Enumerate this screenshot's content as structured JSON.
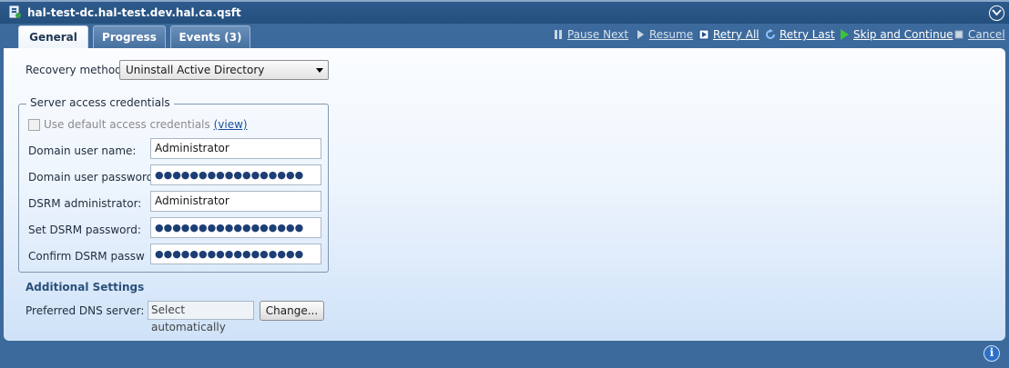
{
  "window": {
    "title": "hal-test-dc.hal-test.dev.hal.ca.qsft"
  },
  "tabs": [
    {
      "label": "General",
      "active": true
    },
    {
      "label": "Progress",
      "active": false
    },
    {
      "label": "Events (3)",
      "active": false
    }
  ],
  "toolbar": {
    "pause_next": "Pause Next",
    "resume": "Resume",
    "retry_all": "Retry All",
    "retry_last": "Retry Last",
    "skip_continue": "Skip and Continue",
    "cancel": "Cancel"
  },
  "general": {
    "recovery_method_label": "Recovery method:",
    "recovery_method_value": "Uninstall Active Directory",
    "credentials_legend": "Server access credentials",
    "use_default_label": "Use default access credentials",
    "use_default_link": "(view)",
    "use_default_checked": false,
    "domain_user_label": "Domain user name:",
    "domain_user_value": "Administrator",
    "domain_password_label": "Domain user password:",
    "domain_password_value": "●●●●●●●●●●●●●●●●●",
    "dsrm_admin_label": "DSRM administrator:",
    "dsrm_admin_value": "Administrator",
    "set_dsrm_password_label": "Set DSRM password:",
    "set_dsrm_password_value": "●●●●●●●●●●●●●●●●●",
    "confirm_dsrm_password_label": "Confirm DSRM passwor",
    "confirm_dsrm_password_value": "●●●●●●●●●●●●●●●●●",
    "additional_settings_title": "Additional Settings",
    "preferred_dns_label": "Preferred DNS server:",
    "preferred_dns_value": "Select automatically",
    "change_button": "Change..."
  },
  "colors": {
    "frame": "#3d6a9c",
    "accent_link": "#1b4f9e",
    "section_title": "#2a4f7a"
  },
  "icons": {
    "app": "server-icon",
    "collapse": "chevron-down-circle-icon",
    "pause": "pause-icon",
    "resume": "play-icon",
    "retry_all": "retry-all-icon",
    "retry_last": "refresh-icon",
    "skip": "green-play-icon",
    "cancel": "cancel-icon",
    "info": "info-icon"
  }
}
